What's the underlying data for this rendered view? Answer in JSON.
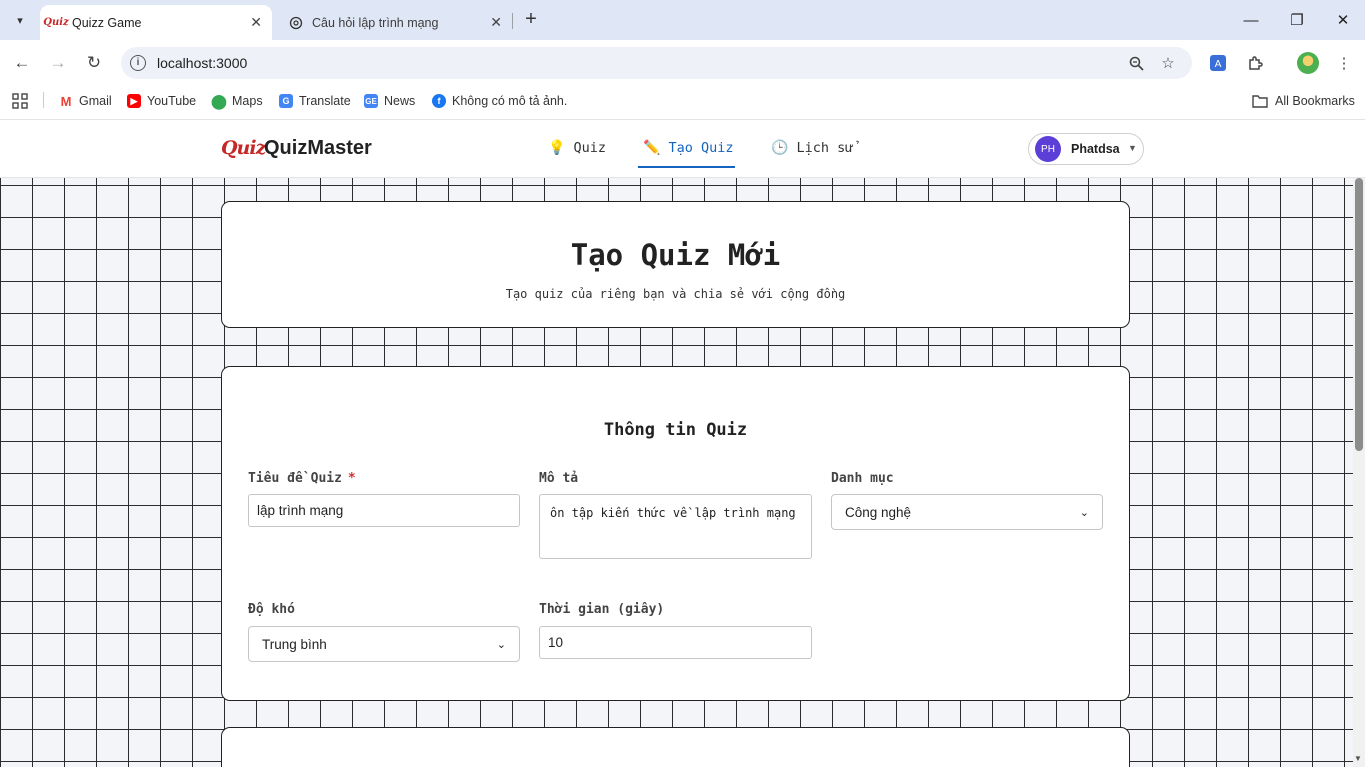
{
  "browser": {
    "tabs": [
      {
        "title": "Quizz Game",
        "icon": "quizz-favicon",
        "icon_text": "Quiz",
        "active": true
      },
      {
        "title": "Câu hỏi lập trình mạng",
        "icon": "openai-icon",
        "active": false
      }
    ],
    "address": "localhost:3000",
    "bookmarks": [
      {
        "label": "Gmail",
        "icon": "gmail-icon",
        "color": "#ea4335"
      },
      {
        "label": "YouTube",
        "icon": "youtube-icon",
        "color": "#ff0000"
      },
      {
        "label": "Maps",
        "icon": "maps-icon",
        "color": "#34a853"
      },
      {
        "label": "Translate",
        "icon": "translate-icon",
        "color": "#4285f4"
      },
      {
        "label": "News",
        "icon": "news-icon",
        "color": "#4285f4"
      },
      {
        "label": "Không có mô tả ảnh.",
        "icon": "facebook-icon",
        "color": "#1877f2"
      }
    ],
    "all_bookmarks": "All Bookmarks"
  },
  "header": {
    "logo_mark": "Quiz",
    "brand": "QuizMaster",
    "nav": [
      {
        "label": "Quiz",
        "icon": "lightbulb-icon",
        "active": false
      },
      {
        "label": "Tạo Quiz",
        "icon": "pencil-icon",
        "active": true
      },
      {
        "label": "Lịch sử",
        "icon": "clock-icon",
        "active": false
      }
    ],
    "user": {
      "initials": "PH",
      "name": "Phatdsa",
      "avatar_color": "#5b3fd6"
    }
  },
  "hero": {
    "title": "Tạo Quiz Mới",
    "subtitle": "Tạo quiz của riêng bạn và chia sẻ với cộng đồng"
  },
  "form": {
    "title": "Thông tin Quiz",
    "fields": {
      "title": {
        "label": "Tiêu đề Quiz",
        "required_mark": "*",
        "value": "lập trình mạng"
      },
      "description": {
        "label": "Mô tả",
        "value": "ôn tập kiến thức về lập trình mạng"
      },
      "category": {
        "label": "Danh mục",
        "value": "Công nghệ"
      },
      "difficulty": {
        "label": "Độ khó",
        "value": "Trung bình"
      },
      "time": {
        "label": "Thời gian (giây)",
        "value": "10"
      }
    }
  },
  "colors": {
    "accent": "#1565c0",
    "required": "#d32f2f",
    "logo": "#c62828"
  }
}
